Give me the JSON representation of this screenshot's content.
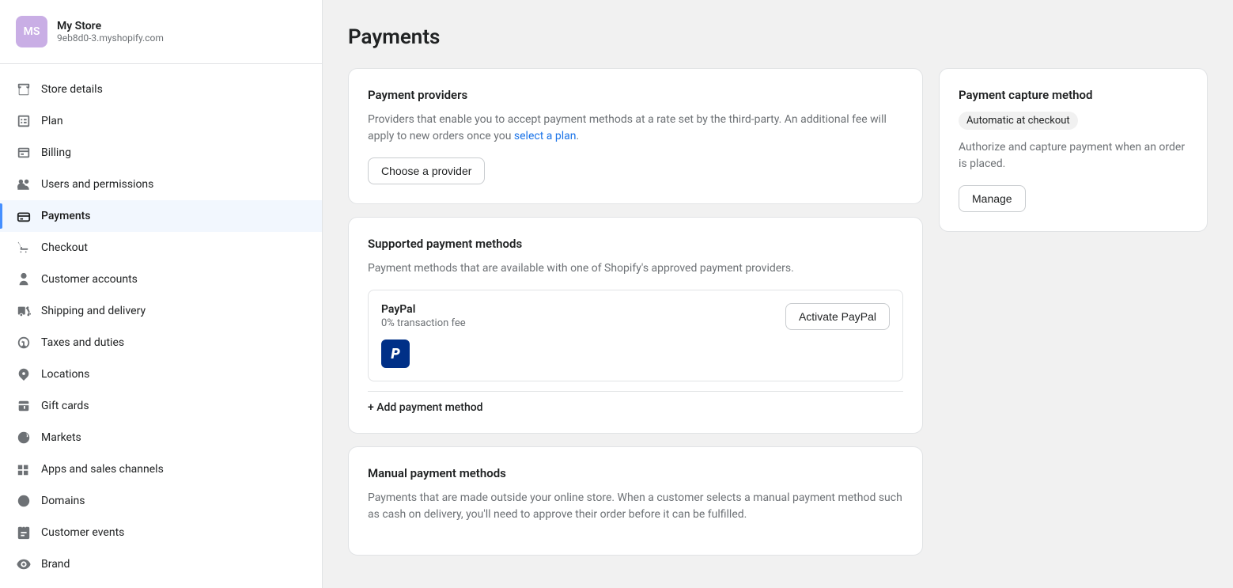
{
  "store": {
    "initials": "MS",
    "name": "My Store",
    "url": "9eb8d0-3.myshopify.com"
  },
  "sidebar": {
    "items": [
      {
        "id": "store-details",
        "label": "Store details",
        "icon": "store"
      },
      {
        "id": "plan",
        "label": "Plan",
        "icon": "plan"
      },
      {
        "id": "billing",
        "label": "Billing",
        "icon": "billing"
      },
      {
        "id": "users-permissions",
        "label": "Users and permissions",
        "icon": "users"
      },
      {
        "id": "payments",
        "label": "Payments",
        "icon": "payments",
        "active": true
      },
      {
        "id": "checkout",
        "label": "Checkout",
        "icon": "checkout"
      },
      {
        "id": "customer-accounts",
        "label": "Customer accounts",
        "icon": "customer-accounts"
      },
      {
        "id": "shipping-delivery",
        "label": "Shipping and delivery",
        "icon": "shipping"
      },
      {
        "id": "taxes-duties",
        "label": "Taxes and duties",
        "icon": "taxes"
      },
      {
        "id": "locations",
        "label": "Locations",
        "icon": "locations"
      },
      {
        "id": "gift-cards",
        "label": "Gift cards",
        "icon": "gift-cards"
      },
      {
        "id": "markets",
        "label": "Markets",
        "icon": "markets"
      },
      {
        "id": "apps-sales",
        "label": "Apps and sales channels",
        "icon": "apps"
      },
      {
        "id": "domains",
        "label": "Domains",
        "icon": "domains"
      },
      {
        "id": "customer-events",
        "label": "Customer events",
        "icon": "customer-events"
      },
      {
        "id": "brand",
        "label": "Brand",
        "icon": "brand"
      }
    ]
  },
  "page": {
    "title": "Payments"
  },
  "payment_providers": {
    "card_title": "Payment providers",
    "description_part1": "Providers that enable you to accept payment methods at a rate set by the third-party. An additional fee will apply to new orders once you ",
    "link_text": "select a plan",
    "description_part2": ".",
    "button_label": "Choose a provider"
  },
  "supported_payment_methods": {
    "card_title": "Supported payment methods",
    "description": "Payment methods that are available with one of Shopify's approved payment providers.",
    "paypal": {
      "name": "PayPal",
      "fee": "0% transaction fee",
      "logo_letter": "P",
      "button_label": "Activate PayPal"
    },
    "add_method_label": "+ Add payment method"
  },
  "manual_payment_methods": {
    "card_title": "Manual payment methods",
    "description": "Payments that are made outside your online store. When a customer selects a manual payment method such as cash on delivery, you'll need to approve their order before it can be fulfilled."
  },
  "payment_capture": {
    "card_title": "Payment capture method",
    "badge_label": "Automatic at checkout",
    "description": "Authorize and capture payment when an order is placed.",
    "button_label": "Manage"
  }
}
